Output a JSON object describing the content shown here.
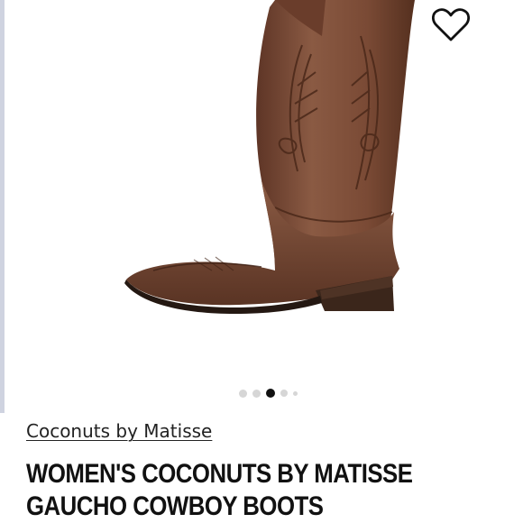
{
  "product_image": {
    "icon": "cowboy-boot-image",
    "colors": {
      "leather": "#7a4a35",
      "leather_dark": "#4f2b1d",
      "heel": "#3b261b",
      "sole": "#241812"
    }
  },
  "wishlist": {
    "icon": "heart-outline-icon"
  },
  "carousel": {
    "dots": [
      {
        "state": "inactive"
      },
      {
        "state": "inactive"
      },
      {
        "state": "active"
      },
      {
        "state": "inactive"
      },
      {
        "state": "inactive"
      }
    ]
  },
  "product": {
    "brand": "Coconuts by Matisse",
    "title_line1": "WOMEN'S COCONUTS BY MATISSE",
    "title_line2": "GAUCHO COWBOY BOOTS"
  }
}
